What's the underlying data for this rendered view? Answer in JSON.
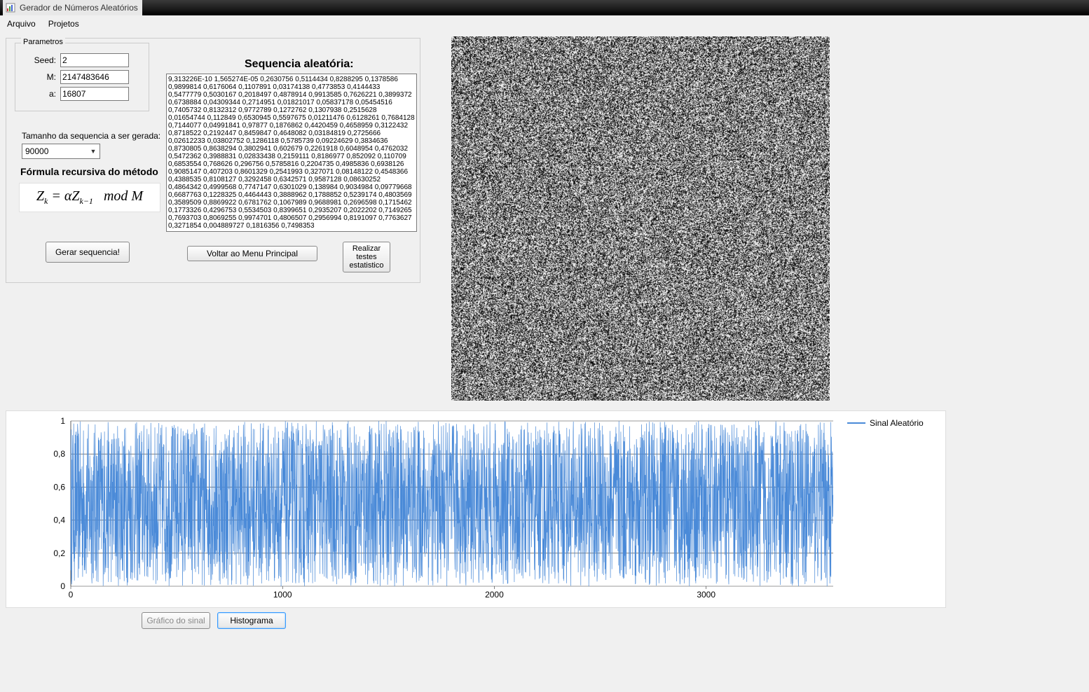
{
  "window": {
    "title": "Gerador de Números Aleatórios"
  },
  "menu": {
    "arquivo": "Arquivo",
    "projetos": "Projetos"
  },
  "params": {
    "legend": "Parametros",
    "seed_label": "Seed:",
    "seed_value": "2",
    "m_label": "M:",
    "m_value": "2147483646",
    "a_label": "a:",
    "a_value": "16807"
  },
  "sequence_size": {
    "label": "Tamanho da sequencia a ser gerada:",
    "value": "90000"
  },
  "formula": {
    "title": "Fórmula recursiva do método"
  },
  "buttons": {
    "gerar": "Gerar sequencia!",
    "voltar": "Voltar ao Menu Principal",
    "testes": "Realizar\ntestes\nestatistico",
    "grafico": "Gráfico do sinal",
    "histograma": "Histograma"
  },
  "sequence": {
    "title": "Sequencia aleatória:",
    "text": "9,313226E-10 1,565274E-05 0,2630756 0,5114434 0,8288295 0,1378586 0,9899814 0,6176064 0,1107891 0,03174138 0,4773853 0,4144433 0,5477779 0,5030167 0,2018497 0,4878914 0,9913585 0,7626221 0,3899372 0,6738884 0,04309344 0,2714951 0,01821017 0,05837178 0,05454516 0,7405732 0,8132312 0,9772789 0,1272762 0,1307938 0,2515628 0,01654744 0,112849 0,6530945 0,5597675 0,01211476 0,6128261 0,7684128 0,7144077 0,04991841 0,97877 0,1876862 0,4420459 0,4658959 0,3122432 0,8718522 0,2192447 0,8459847 0,4648082 0,03184819 0,2725666 0,02612233 0,03802752 0,1286118 0,5785739 0,09224629 0,3834636 0,8730805 0,8638294 0,3802941 0,602679 0,2261918 0,6048954 0,4762032 0,5472362 0,3988831 0,02833438 0,2159111 0,8186977 0,852092 0,110709 0,6853554 0,768626 0,296756 0,5785816 0,2204735 0,4985836 0,6938126 0,9085147 0,407203 0,8601329 0,2541993 0,327071 0,08148122 0,4548366 0,4388535 0,8108127 0,3292458 0,6342571 0,9587128 0,08630252 0,4864342 0,4999568 0,7747147 0,6301029 0,138984 0,9034984 0,09779668 0,6687763 0,1228325 0,4464443 0,3888962 0,1788852 0,5239174 0,4803569 0,3589509 0,8869922 0,6781762 0,1067989 0,9688981 0,2696598 0,1715462 0,1773326 0,4296753 0,5534503 0,8399651 0,2935207 0,2022202 0,7149265 0,7693703 0,8069255 0,9974701 0,4806507 0,2956994 0,8191097 0,7763627 0,3271854 0,004889727 0,1816356 0,7498353"
  },
  "chart_data": {
    "type": "line",
    "title": "",
    "xlabel": "",
    "ylabel": "",
    "xlim": [
      0,
      3600
    ],
    "ylim": [
      0,
      1
    ],
    "xticks": [
      0,
      1000,
      2000,
      3000
    ],
    "yticks": [
      0,
      0.2,
      0.4,
      0.6,
      0.8,
      1
    ],
    "ytick_labels": [
      "0",
      "0,2",
      "0,4",
      "0,6",
      "0,8",
      "1"
    ],
    "series": [
      {
        "name": "Sinal Aleatório",
        "color": "#4a8ad8",
        "n_points": 3600,
        "value_range": [
          0,
          1
        ],
        "note": "uniform pseudo-random noise rendered as dense vertical line plot"
      }
    ]
  }
}
